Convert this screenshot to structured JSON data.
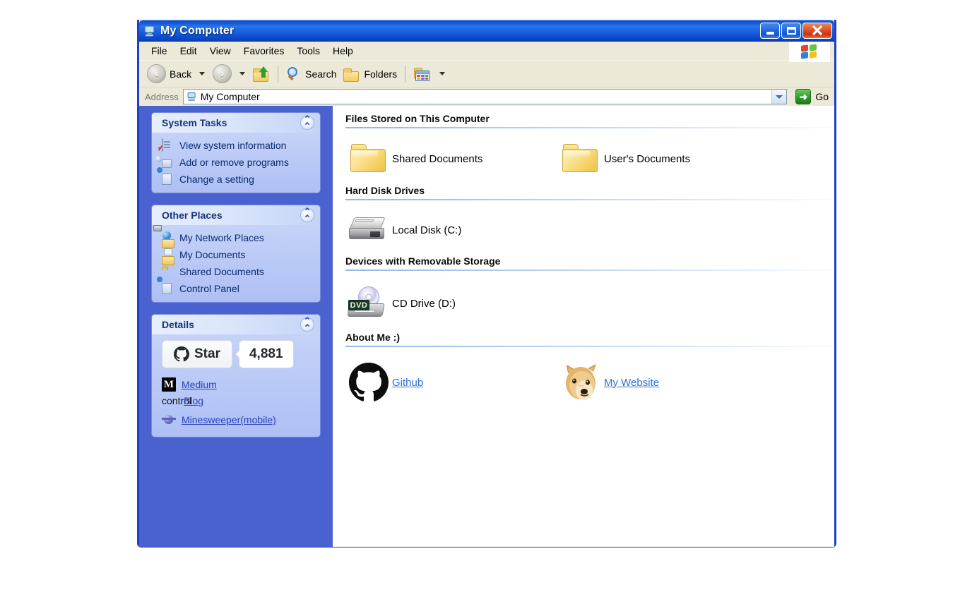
{
  "window": {
    "title": "My Computer",
    "title_icon": "my-computer-icon",
    "buttons": {
      "minimize": "_",
      "maximize": "□",
      "close": "✕"
    }
  },
  "menu": {
    "items": [
      "File",
      "Edit",
      "View",
      "Favorites",
      "Tools",
      "Help"
    ],
    "brand_icon": "windows-flag-icon"
  },
  "toolbar": {
    "back": "Back",
    "forward": "",
    "up_icon": "up-folder-icon",
    "search": "Search",
    "folders": "Folders",
    "views_icon": "views-icon"
  },
  "address": {
    "label": "Address",
    "value": "My Computer",
    "icon": "my-computer-icon",
    "go": "Go"
  },
  "sidebar": {
    "panels": [
      {
        "title": "System Tasks",
        "collapse_icon": "chevron-up-icon",
        "items": [
          {
            "label": "View system information",
            "icon": "system-info-icon"
          },
          {
            "label": "Add or remove programs",
            "icon": "add-remove-programs-icon"
          },
          {
            "label": "Change a setting",
            "icon": "change-setting-icon"
          }
        ]
      },
      {
        "title": "Other Places",
        "collapse_icon": "chevron-up-icon",
        "items": [
          {
            "label": "My Network Places",
            "icon": "network-places-icon"
          },
          {
            "label": "My Documents",
            "icon": "my-documents-icon"
          },
          {
            "label": "Shared Documents",
            "icon": "shared-documents-icon"
          },
          {
            "label": "Control Panel",
            "icon": "control-panel-icon"
          }
        ]
      },
      {
        "title": "Details",
        "collapse_icon": "chevron-up-icon",
        "github_star": {
          "label": "Star",
          "count": "4,881",
          "icon": "github-mark-icon"
        },
        "links": [
          {
            "label": "Medium",
            "icon": "medium-icon"
          },
          {
            "label": "Blog",
            "icon": "",
            "overlap_text": "control"
          },
          {
            "label": "Minesweeper(mobile)",
            "icon": "minesweeper-icon"
          }
        ]
      }
    ]
  },
  "content": {
    "sections": [
      {
        "title": "Files Stored on This Computer",
        "items": [
          {
            "name": "Shared Documents",
            "icon": "folder-icon",
            "link": false
          },
          {
            "name": "User's Documents",
            "icon": "folder-icon",
            "link": false
          }
        ]
      },
      {
        "title": "Hard Disk Drives",
        "items": [
          {
            "name": "Local Disk (C:)",
            "icon": "hard-disk-icon",
            "link": false
          }
        ]
      },
      {
        "title": "Devices with Removable Storage",
        "items": [
          {
            "name": "CD Drive (D:)",
            "icon": "cd-drive-icon",
            "badge": "DVD",
            "link": false
          }
        ]
      },
      {
        "title": "About Me :)",
        "items": [
          {
            "name": "Github",
            "icon": "github-mark-icon",
            "link": true
          },
          {
            "name": "My Website",
            "icon": "doge-icon",
            "link": true
          }
        ]
      }
    ]
  },
  "colors": {
    "titlebar_blue": "#0e55d2",
    "sidebar_blue": "#4a61d0",
    "panel_body": "#bcccf7",
    "link_blue": "#2a3fb8",
    "content_link": "#2a6fd8",
    "window_border": "#1c3fc4",
    "chrome_beige": "#ece9d8",
    "close_red": "#e4562a",
    "go_green": "#2f9c2a"
  }
}
